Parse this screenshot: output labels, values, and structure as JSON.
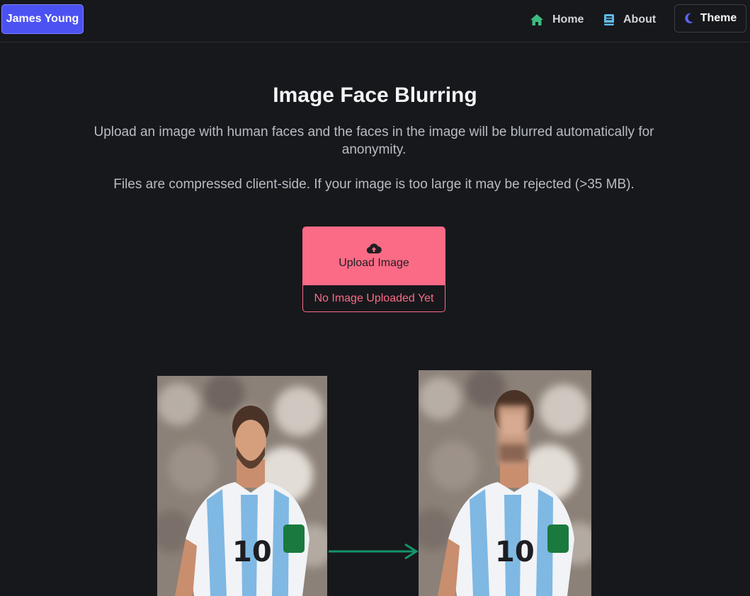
{
  "navbar": {
    "brand": "James Young",
    "links": [
      {
        "label": "Home",
        "icon": "home-icon",
        "color": "#3dba7e"
      },
      {
        "label": "About",
        "icon": "book-icon",
        "color": "#60b8e8"
      }
    ],
    "theme_button": {
      "label": "Theme",
      "icon": "moon-icon",
      "color": "#5b63f5"
    }
  },
  "main": {
    "title": "Image Face Blurring",
    "description": "Upload an image with human faces and the faces in the image will be blurred automatically for anonymity.",
    "note": "Files are compressed client-side. If your image is too large it may be rejected (>35 MB)."
  },
  "upload": {
    "button_label": "Upload Image",
    "icon": "cloud-upload-icon",
    "status": "No Image Uploaded Yet",
    "accent": "#fb6b86"
  },
  "example": {
    "arrow_color": "#14956a",
    "before_image": "example-photo-original",
    "after_image": "example-photo-face-blurred"
  }
}
